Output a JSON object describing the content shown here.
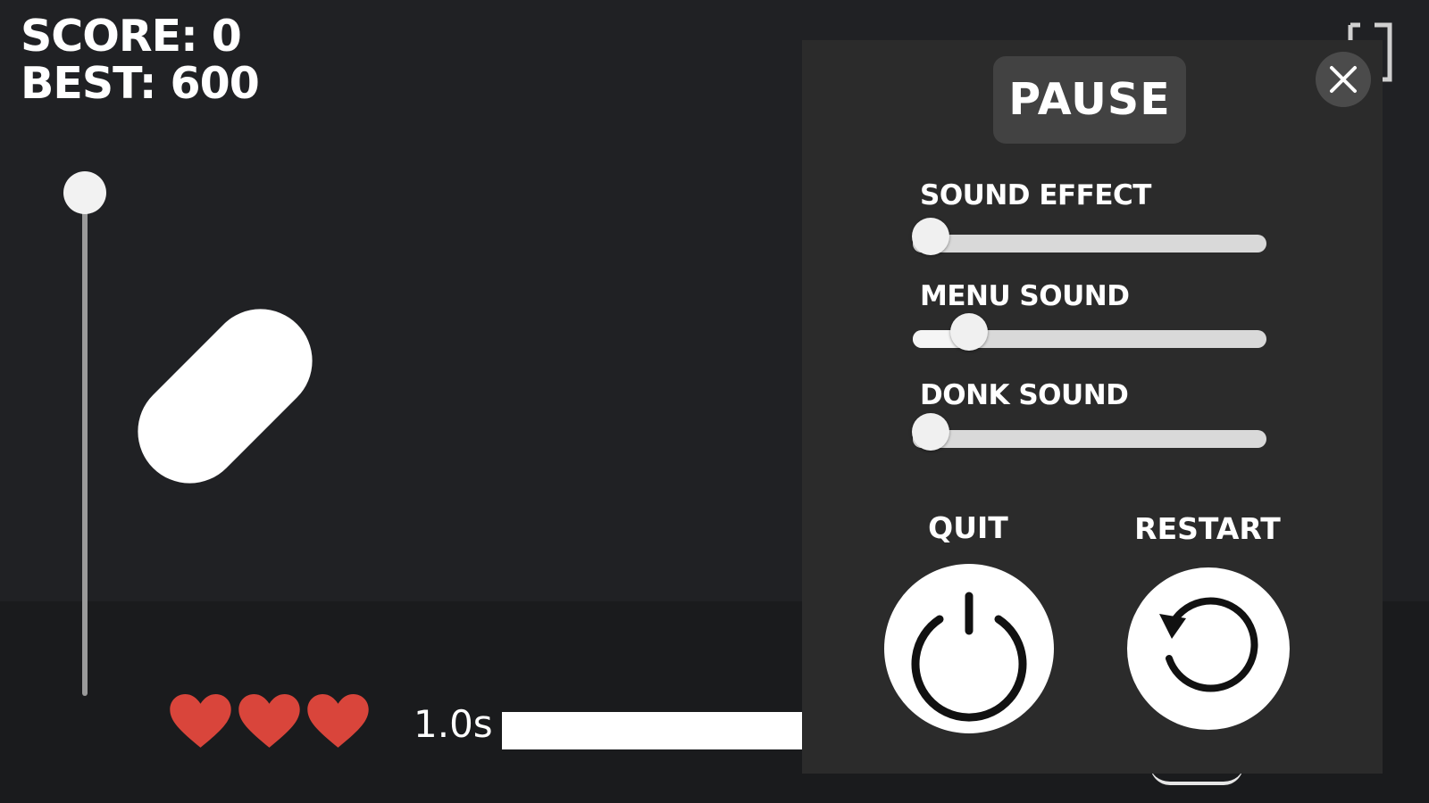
{
  "hud": {
    "score_label": "SCORE: 0",
    "best_label": "BEST: 600",
    "score": 0,
    "best": 600,
    "lives": 3,
    "timer_text": "1.0s"
  },
  "pause_menu": {
    "title": "PAUSE",
    "sliders": [
      {
        "label": "SOUND EFFECT",
        "value": 0.05
      },
      {
        "label": "MENU SOUND",
        "value": 0.16
      },
      {
        "label": "DONK SOUND",
        "value": 0.05
      }
    ],
    "quit_label": "QUIT",
    "restart_label": "RESTART"
  },
  "icons": {
    "close": "close-icon",
    "quit": "power-icon",
    "restart": "restart-icon",
    "fullscreen": "fullscreen-icon",
    "heart": "heart-icon"
  },
  "colors": {
    "background": "#202124",
    "panel": "#2b2b2b",
    "heart": "#d9453b",
    "white": "#ffffff"
  }
}
